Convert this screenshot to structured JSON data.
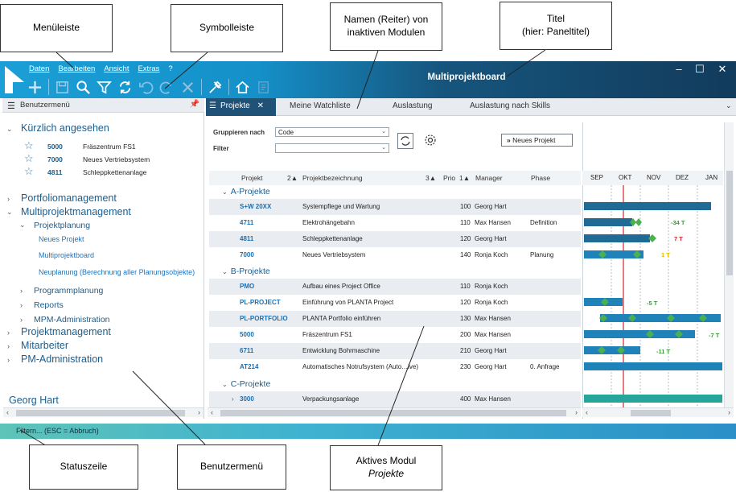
{
  "app": {
    "title": "Multiprojektboard",
    "menu": [
      "Daten",
      "Bearbeiten",
      "Ansicht",
      "Extras",
      "?"
    ],
    "window_controls": [
      "–",
      "☐",
      "✕"
    ]
  },
  "toolbar_icons": [
    "new-icon",
    "save-icon",
    "search-icon",
    "filter-icon",
    "refresh-icon",
    "undo-icon",
    "redo-icon",
    "delete-icon",
    "tools-icon",
    "home-icon",
    "report-icon"
  ],
  "left_panel": {
    "header": "Benutzermenü",
    "recent_title": "Kürzlich angesehen",
    "recent": [
      {
        "id": "5000",
        "name": "Fräszentrum FS1"
      },
      {
        "id": "7000",
        "name": "Neues Vertriebsystem"
      },
      {
        "id": "4811",
        "name": "Schleppkettenanlage"
      }
    ],
    "nav": {
      "portfolio": "Portfoliomanagement",
      "multi": "Multiprojektmanagement",
      "planung": "Projektplanung",
      "neues": "Neues Projekt",
      "board": "Multiprojektboard",
      "neuplanung": "Neuplanung (Berechnung aller Planungsobjekte)",
      "programm": "Programmplanung",
      "reports": "Reports",
      "mpmadmin": "MPM-Administration",
      "projektmgmt": "Projektmanagement",
      "mitarbeiter": "Mitarbeiter",
      "pmadmin": "PM-Administration"
    },
    "user": "Georg Hart"
  },
  "tabs": [
    {
      "label": "Projekte",
      "active": true
    },
    {
      "label": "Meine Watchliste"
    },
    {
      "label": "Auslastung"
    },
    {
      "label": "Auslastung nach Skills"
    }
  ],
  "form": {
    "group_label": "Gruppieren nach",
    "group_value": "Code",
    "filter_label": "Filter",
    "filter_value": "",
    "new_project": "Neues Projekt"
  },
  "columns": {
    "projekt": "Projekt",
    "sort2": "2▲",
    "bezeichnung": "Projektbezeichnung",
    "sort3": "3▲",
    "prio": "Prio",
    "sort1": "1▲",
    "manager": "Manager",
    "phase": "Phase"
  },
  "groups": [
    {
      "label": "A-Projekte",
      "rows": [
        {
          "id": "S+W 20XX",
          "name": "Systempflege und Wartung",
          "prio": "100",
          "manager": "Georg Hart",
          "phase": ""
        },
        {
          "id": "4711",
          "name": "Elektrohängebahn",
          "prio": "110",
          "manager": "Max Hansen",
          "phase": "Definition"
        },
        {
          "id": "4811",
          "name": "Schleppkettenanlage",
          "prio": "120",
          "manager": "Georg Hart",
          "phase": ""
        },
        {
          "id": "7000",
          "name": "Neues Vertriebsystem",
          "prio": "140",
          "manager": "Ronja Koch",
          "phase": "Planung"
        }
      ]
    },
    {
      "label": "B-Projekte",
      "rows": [
        {
          "id": "PMO",
          "name": "Aufbau eines Project Office",
          "prio": "110",
          "manager": "Ronja Koch",
          "phase": ""
        },
        {
          "id": "PL-PROJECT",
          "name": "Einführung von PLANTA Project",
          "prio": "120",
          "manager": "Ronja Koch",
          "phase": ""
        },
        {
          "id": "PL-PORTFOLIO",
          "name": "PLANTA Portfolio einführen",
          "prio": "130",
          "manager": "Max Hansen",
          "phase": ""
        },
        {
          "id": "5000",
          "name": "Fräszentrum FS1",
          "prio": "200",
          "manager": "Max Hansen",
          "phase": ""
        },
        {
          "id": "6711",
          "name": "Entwicklung Bohrmaschine",
          "prio": "210",
          "manager": "Georg Hart",
          "phase": ""
        },
        {
          "id": "AT214",
          "name": "Automatisches Notrufsystem (Auto…ive)",
          "prio": "230",
          "manager": "Georg Hart",
          "phase": "0. Anfrage"
        }
      ]
    },
    {
      "label": "C-Projekte",
      "rows": [
        {
          "id": "3000",
          "name": "Verpackungsanlage",
          "prio": "400",
          "manager": "Max Hansen",
          "phase": ""
        }
      ]
    }
  ],
  "gantt": {
    "months": [
      "SEP",
      "OKT",
      "NOV",
      "DEZ",
      "JAN"
    ],
    "labels": [
      "-34 T",
      "7 T",
      "1 T",
      "-5 T",
      "-7 T",
      "-11 T"
    ]
  },
  "statusbar": "Filtern... (ESC = Abbruch)",
  "callouts": {
    "menuleiste": "Menüleiste",
    "symbolleiste": "Symbolleiste",
    "namen_l1": "Namen (Reiter) von",
    "namen_l2": "inaktiven Modulen",
    "titel_l1": "Titel",
    "titel_l2": "(hier: Paneltitel)",
    "statuszeile": "Statuszeile",
    "benutzermenue": "Benutzermenü",
    "aktives_l1": "Aktives Modul",
    "aktives_l2": "Projekte"
  }
}
